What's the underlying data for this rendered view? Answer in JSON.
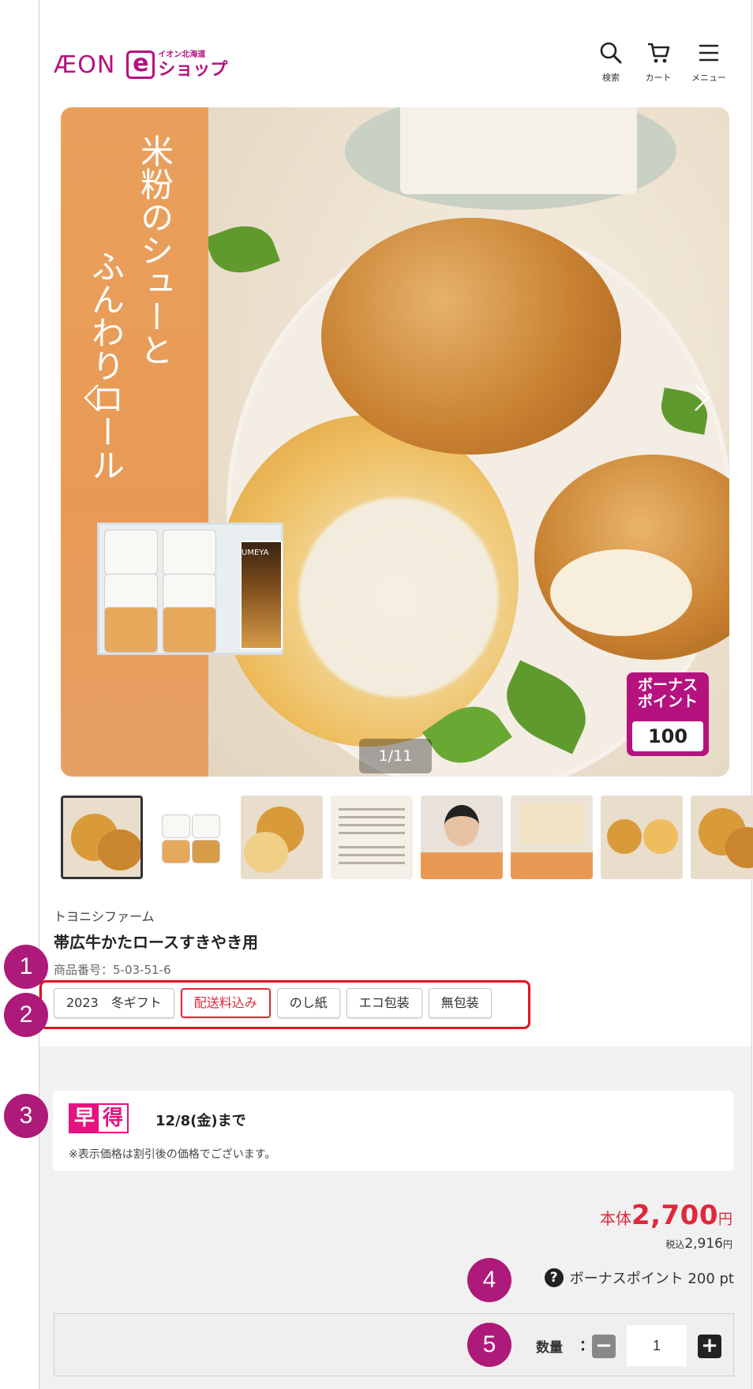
{
  "header": {
    "logo_aeon": "ÆON",
    "logo_e": "e",
    "logo_small": "イオン北海道",
    "logo_shop": "ショップ",
    "search_label": "検索",
    "cart_label": "カート",
    "menu_label": "メニュー"
  },
  "hero": {
    "title_col1": "米粉のシューと",
    "title_col2": "ふんわりロール",
    "bonus_line1": "ボーナス",
    "bonus_line2": "ポイント",
    "bonus_points": "100",
    "counter": "1/11",
    "box_text": "UMEYA"
  },
  "product": {
    "maker": "トヨニシファーム",
    "name": "帯広牛かたロースすきやき用",
    "number": "商品番号：5-03-51-6",
    "tags": [
      "2023　冬ギフト",
      "配送料込み",
      "のし紙",
      "エコ包装",
      "無包装"
    ]
  },
  "markers": [
    "1",
    "2",
    "3",
    "4",
    "5"
  ],
  "promo": {
    "badge_a": "早",
    "badge_b": "得",
    "until": "12/8(金)まで",
    "note": "※表示価格は割引後の価格でございます。"
  },
  "price": {
    "pre": "本体",
    "value": "2,700",
    "yen": "円",
    "tax_pre": "税込",
    "tax_value": "2,916",
    "tax_yen": "円"
  },
  "bonus": {
    "text": "ボーナスポイント 200 pt"
  },
  "quantity": {
    "label": "数量",
    "colon": "：",
    "value": "1"
  },
  "colors": {
    "brand": "#b5127f",
    "accent_red": "#e0283a",
    "marker": "#ad1a7a"
  }
}
